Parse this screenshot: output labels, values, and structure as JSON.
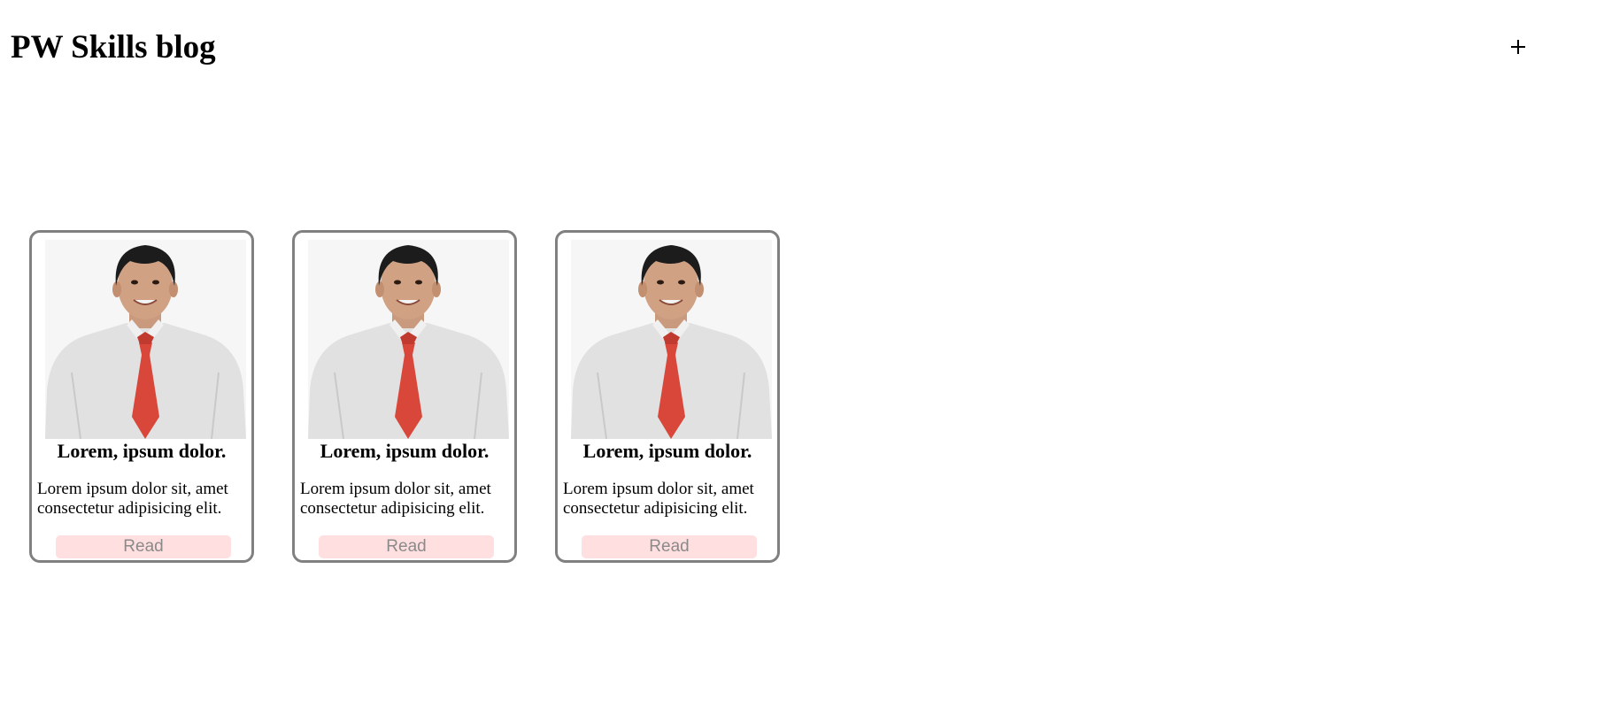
{
  "header": {
    "title": "PW Skills blog",
    "add_icon": "plus-icon"
  },
  "cards": [
    {
      "image_icon": "portrait-photo",
      "title": "Lorem, ipsum dolor.",
      "text": "Lorem ipsum dolor sit, amet consectetur adipisicing elit.",
      "button_label": "Read"
    },
    {
      "image_icon": "portrait-photo",
      "title": "Lorem, ipsum dolor.",
      "text": "Lorem ipsum dolor sit, amet consectetur adipisicing elit.",
      "button_label": "Read"
    },
    {
      "image_icon": "portrait-photo",
      "title": "Lorem, ipsum dolor.",
      "text": "Lorem ipsum dolor sit, amet consectetur adipisicing elit.",
      "button_label": "Read"
    }
  ],
  "colors": {
    "card_border": "#808080",
    "button_bg": "#ffdfe0",
    "button_text": "#8a8a8a",
    "tie": "#d9473a",
    "shirt": "#e1e1e1"
  }
}
